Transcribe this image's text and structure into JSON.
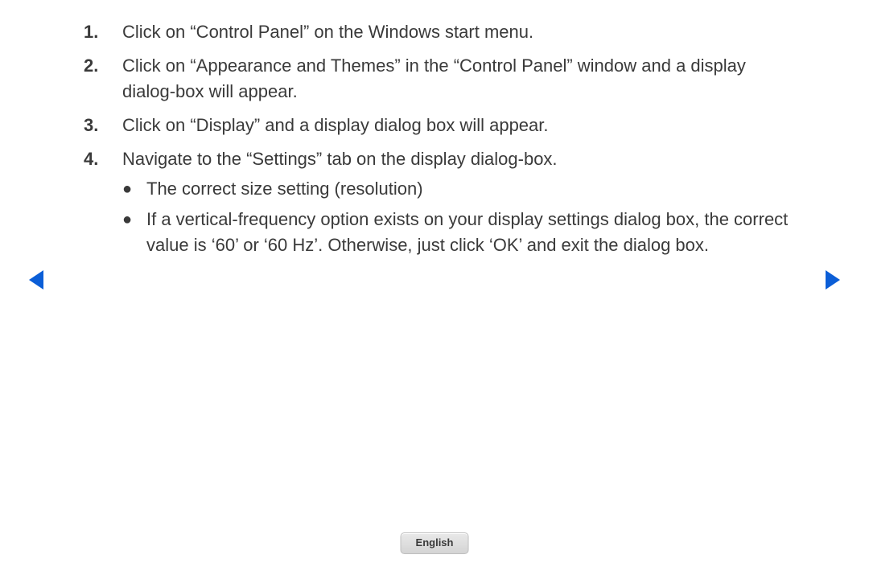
{
  "steps": [
    {
      "num": "1.",
      "text": "Click on “Control Panel” on the Windows start menu."
    },
    {
      "num": "2.",
      "text": "Click on “Appearance and Themes” in the “Control Panel” window and a display dialog-box will appear."
    },
    {
      "num": "3.",
      "text": "Click on “Display” and a display dialog box will appear."
    },
    {
      "num": "4.",
      "text": "Navigate to the “Settings” tab on the display dialog-box.",
      "sub": [
        "The correct size setting (resolution)",
        "If a vertical-frequency option exists on your display settings dialog box, the correct value is ‘60’ or ‘60 Hz’. Otherwise, just click ‘OK’ and exit the dialog box."
      ]
    }
  ],
  "language_label": "English"
}
